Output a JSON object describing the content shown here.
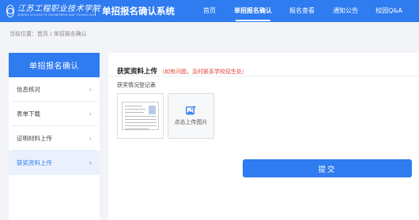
{
  "brand": {
    "school_name_cn": "江苏工程职业技术学院",
    "school_name_en": "JIANGSU COLLEGE OF ENGINEERING AND TECHNOLOGY",
    "system_title": "单招报名确认系统"
  },
  "nav": {
    "items": [
      {
        "label": "首页"
      },
      {
        "label": "单招报名确认"
      },
      {
        "label": "报名查看"
      },
      {
        "label": "通知公告"
      },
      {
        "label": "校园Q&A"
      }
    ]
  },
  "breadcrumb": {
    "text": "当前位置：首页 / 单招报名确认"
  },
  "sidebar": {
    "header": "单招报名确认",
    "items": [
      {
        "label": "信息核对",
        "chevron": "›"
      },
      {
        "label": "表单下载",
        "chevron": "›"
      },
      {
        "label": "证明材料上传",
        "chevron": "›"
      },
      {
        "label": "获奖资料上传",
        "chevron": "›"
      }
    ]
  },
  "main": {
    "title": "获奖资料上传",
    "hint": "（如有问题，及时联系学校招生处）",
    "sub_label": "获奖情况登记表",
    "upload_label": "点击上传图片",
    "submit_label": "提交"
  },
  "colors": {
    "primary": "#2f7bf0",
    "hint_red": "#e0443a",
    "page_bg": "#f2f4f7"
  },
  "icons": {
    "upload": "image-upload-icon",
    "chevron": "chevron-right-icon",
    "logo": "school-emblem-icon"
  }
}
